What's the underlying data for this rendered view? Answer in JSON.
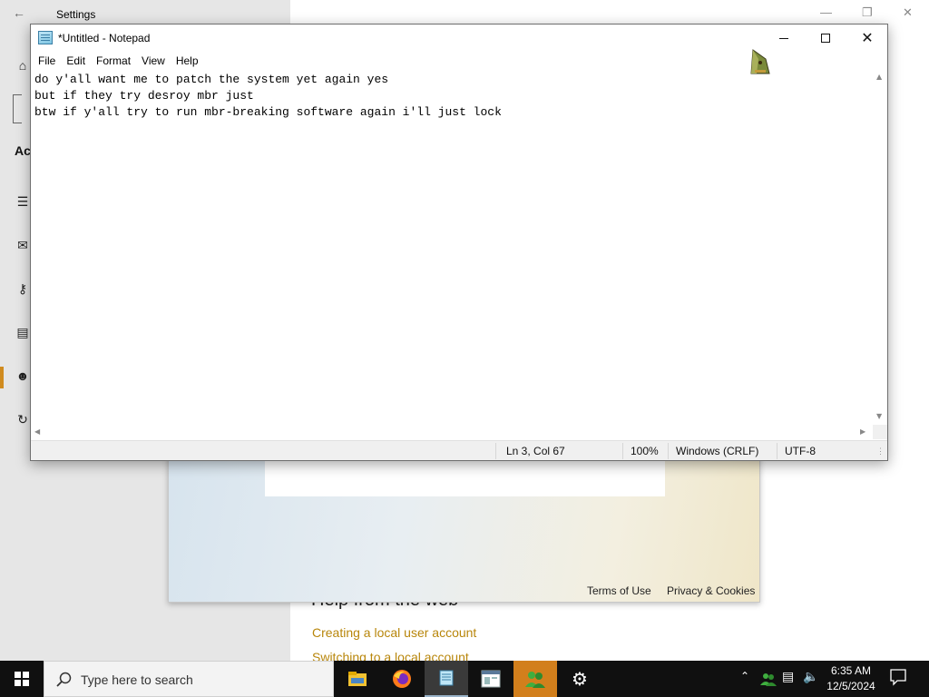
{
  "settings": {
    "title": "Settings",
    "section_fragment": "Ac",
    "help_heading": "Help from the web",
    "links": [
      "Creating a local user account",
      "Switching to a local account"
    ]
  },
  "ms_dialog": {
    "terms": "Terms of Use",
    "privacy": "Privacy & Cookies"
  },
  "notepad": {
    "title": "*Untitled - Notepad",
    "menu": [
      "File",
      "Edit",
      "Format",
      "View",
      "Help"
    ],
    "lines": [
      "do y'all want me to patch the system yet again yes",
      "but if they try desroy mbr just",
      "btw if y'all try to run mbr-breaking software again i'll just lock"
    ],
    "status": {
      "position": "Ln 3, Col 67",
      "zoom": "100%",
      "line_ending": "Windows (CRLF)",
      "encoding": "UTF-8"
    }
  },
  "taskbar": {
    "search_placeholder": "Type here to search",
    "apps": [
      "file-explorer",
      "firefox",
      "notepad",
      "app-window",
      "users-app",
      "settings"
    ],
    "time": "6:35 AM",
    "date": "12/5/2024"
  },
  "colors": {
    "accent_orange": "#d27f1c",
    "link_gold": "#b8860b",
    "taskbar": "#101010"
  }
}
